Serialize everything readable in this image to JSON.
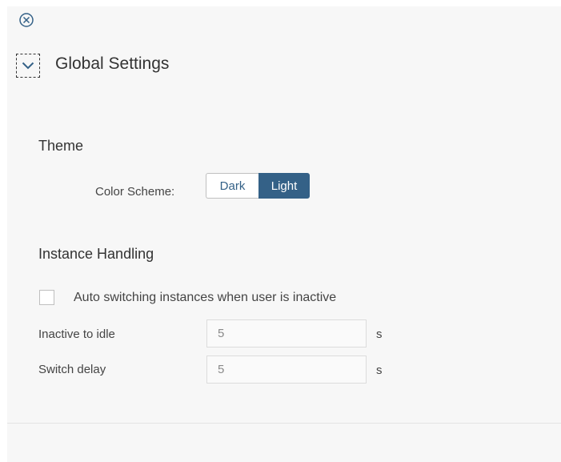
{
  "header": {
    "close_icon": "close-circle-icon",
    "collapse_icon": "chevron-down-icon",
    "title": "Global Settings"
  },
  "theme": {
    "section_title": "Theme",
    "color_scheme_label": "Color Scheme:",
    "options": [
      "Dark",
      "Light"
    ],
    "selected": "Light"
  },
  "instance_handling": {
    "section_title": "Instance Handling",
    "auto_switch_label": "Auto switching instances when user is inactive",
    "auto_switch_checked": false,
    "inactive_label": "Inactive to idle",
    "inactive_value": "5",
    "inactive_unit": "s",
    "switch_delay_label": "Switch delay",
    "switch_delay_value": "5",
    "switch_delay_unit": "s"
  },
  "colors": {
    "accent": "#346187",
    "panel_background": "#f7f7f7"
  }
}
